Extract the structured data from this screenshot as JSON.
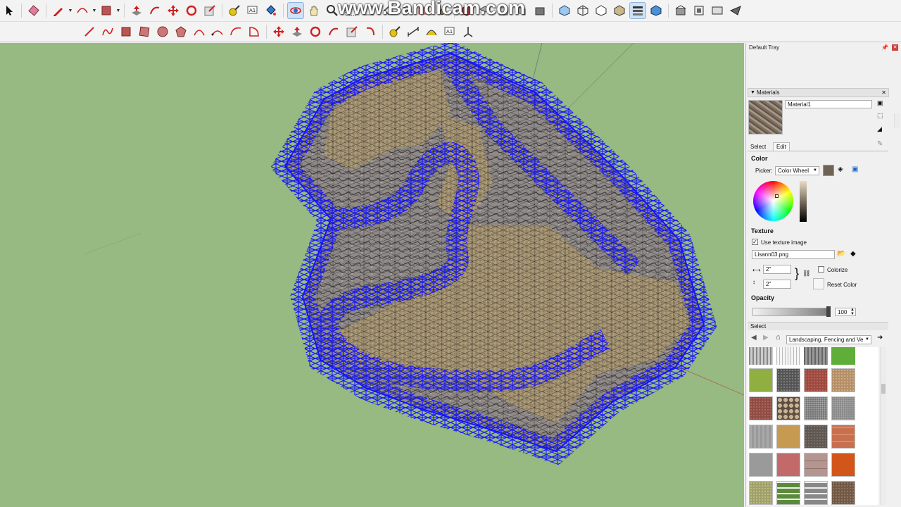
{
  "watermark": "www.Bandicam.com",
  "tray": {
    "title": "Default Tray",
    "materials_panel": {
      "title": "Materials",
      "material_name": "Material1",
      "tabs": [
        "Select",
        "Edit"
      ],
      "color_section": "Color",
      "picker_label": "Picker:",
      "picker_value": "Color Wheel",
      "texture_section": "Texture",
      "use_texture_label": "Use texture image",
      "texture_file": "Lisann03.png",
      "width_value": "2\"",
      "height_value": "2\"",
      "colorize_label": "Colorize",
      "reset_color_label": "Reset Color",
      "opacity_section": "Opacity",
      "opacity_value": "100",
      "select_section": "Select",
      "collection_value": "Landscaping, Fencing and Ve"
    }
  },
  "colors": {
    "viewport_bg": "#97b982",
    "mesh_blue": "#1414ff",
    "terrain_tan": "#a08f6e"
  },
  "toolbar_row1_icons": [
    "select-icon",
    "eraser-icon",
    "pencil-icon",
    "arc-icon",
    "rectangle-icon",
    "push-pull-icon",
    "follow-me-icon",
    "move-icon",
    "rotate-icon",
    "scale-icon",
    "tape-icon",
    "text-icon",
    "paint-bucket-icon",
    "orbit-icon",
    "pan-icon",
    "zoom-icon",
    "zoom-window-icon",
    "zoom-extents-icon",
    "previous-icon",
    "next-icon",
    "section-icon",
    "sandbox-icon",
    "view-iso-icon",
    "view-top-icon",
    "view-front-icon",
    "view-right-icon",
    "view-back-icon",
    "view-left-icon",
    "xray-icon",
    "wireframe-icon",
    "hidden-line-icon",
    "shaded-icon",
    "shaded-textures-icon",
    "monochrome-icon",
    "warehouse-icon",
    "extension-icon",
    "layout-icon",
    "send-icon"
  ],
  "toolbar_row2_icons": [
    "line-icon",
    "freehand-icon",
    "rectangle-icon",
    "rotated-rect-icon",
    "circle-icon",
    "polygon-icon",
    "arc-icon",
    "two-point-arc-icon",
    "three-point-arc-icon",
    "pie-icon",
    "move-icon",
    "push-pull-icon",
    "rotate-icon",
    "follow-me-icon",
    "scale-icon",
    "offset-icon",
    "tape-icon",
    "dimension-icon",
    "protractor-icon",
    "text-icon",
    "axes-icon"
  ]
}
